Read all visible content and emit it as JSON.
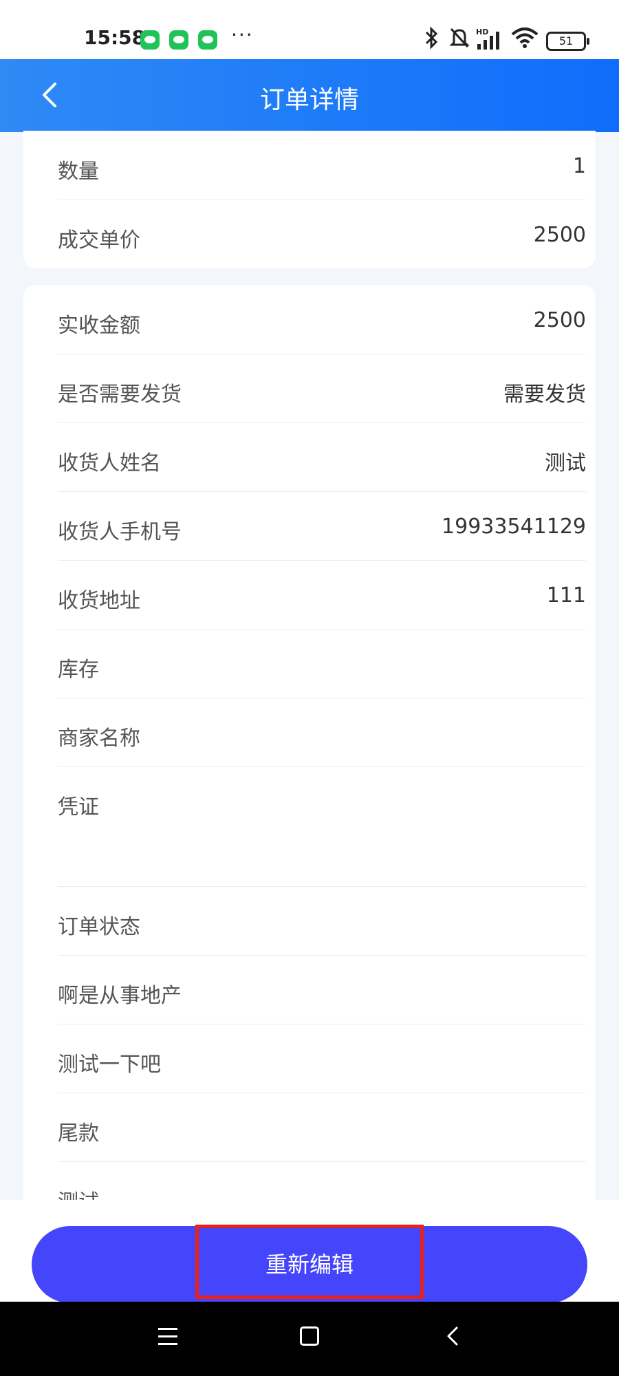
{
  "status_bar": {
    "time": "15:58",
    "notification_icons": [
      "wechat-icon",
      "wechat-icon",
      "wechat-icon"
    ],
    "more": "···",
    "signal_label": "HD",
    "battery": "51"
  },
  "header": {
    "title": "订单详情",
    "gradient_start": "#2f8af5",
    "gradient_end": "#0f6dfb"
  },
  "card1": {
    "rows": [
      {
        "label": "数量",
        "value": "1"
      },
      {
        "label": "成交单价",
        "value": "2500"
      }
    ]
  },
  "card2": {
    "rows": [
      {
        "label": "实收金额",
        "value": "2500"
      },
      {
        "label": "是否需要发货",
        "value": "需要发货"
      },
      {
        "label": "收货人姓名",
        "value": "测试"
      },
      {
        "label": "收货人手机号",
        "value": "19933541129"
      },
      {
        "label": "收货地址",
        "value": "111"
      },
      {
        "label": "库存",
        "value": ""
      },
      {
        "label": "商家名称",
        "value": ""
      },
      {
        "label": "凭证",
        "value": ""
      },
      {
        "label": "订单状态",
        "value": ""
      },
      {
        "label": "啊是从事地产",
        "value": ""
      },
      {
        "label": "测试一下吧",
        "value": ""
      },
      {
        "label": "尾款",
        "value": ""
      },
      {
        "label": "测试",
        "value": ""
      }
    ]
  },
  "bottom": {
    "reedit_label": "重新编辑",
    "button_color": "#4545fc",
    "highlight_color": "#e8211a"
  }
}
